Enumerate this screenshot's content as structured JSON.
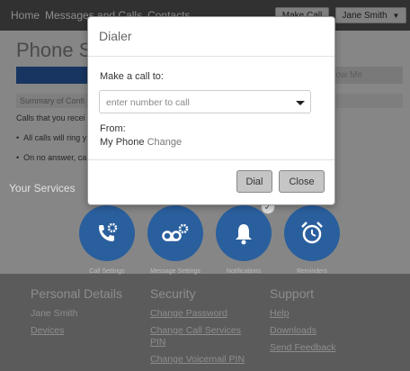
{
  "nav": {
    "items": [
      "Home",
      "Messages and Calls",
      "Contacts"
    ]
  },
  "header": {
    "make_call_label": "Make Call",
    "user_name": "Jane Smith"
  },
  "page": {
    "title": "Phone S",
    "active_tab_label": "Summ",
    "other_tab_label": "llow Me",
    "summary_label": "Summary of Confi",
    "calls_text": "Calls that you recei",
    "bullet1": "All calls will ring y",
    "bullet2": "On no answer, ca"
  },
  "services": {
    "heading": "Your Services",
    "items": [
      {
        "label": "Call Settings",
        "icon": "phone-gear-icon"
      },
      {
        "label": "Message Settings",
        "icon": "voicemail-gear-icon"
      },
      {
        "label": "Notifications",
        "icon": "bell-icon"
      },
      {
        "label": "Reminders",
        "icon": "alarm-clock-icon"
      }
    ]
  },
  "footer": {
    "personal": {
      "title": "Personal Details",
      "name": "Jane Smith",
      "devices_link": "Devices"
    },
    "security": {
      "title": "Security",
      "links": [
        "Change Password",
        "Change Call Services PIN",
        "Change Voicemail PIN"
      ]
    },
    "support": {
      "title": "Support",
      "links": [
        "Help",
        "Downloads",
        "Send Feedback"
      ]
    }
  },
  "dialog": {
    "title": "Dialer",
    "make_call_label": "Make a call to:",
    "number_placeholder": "enter number to call",
    "from_label": "From:",
    "from_value": "My Phone",
    "change_link": "Change",
    "dial_label": "Dial",
    "close_label": "Close"
  },
  "colors": {
    "accent": "#2a62b0",
    "service_circle": "#2a5f9e",
    "nav_bg": "#5a5a5a",
    "footer_bg": "#a6a6a6"
  }
}
